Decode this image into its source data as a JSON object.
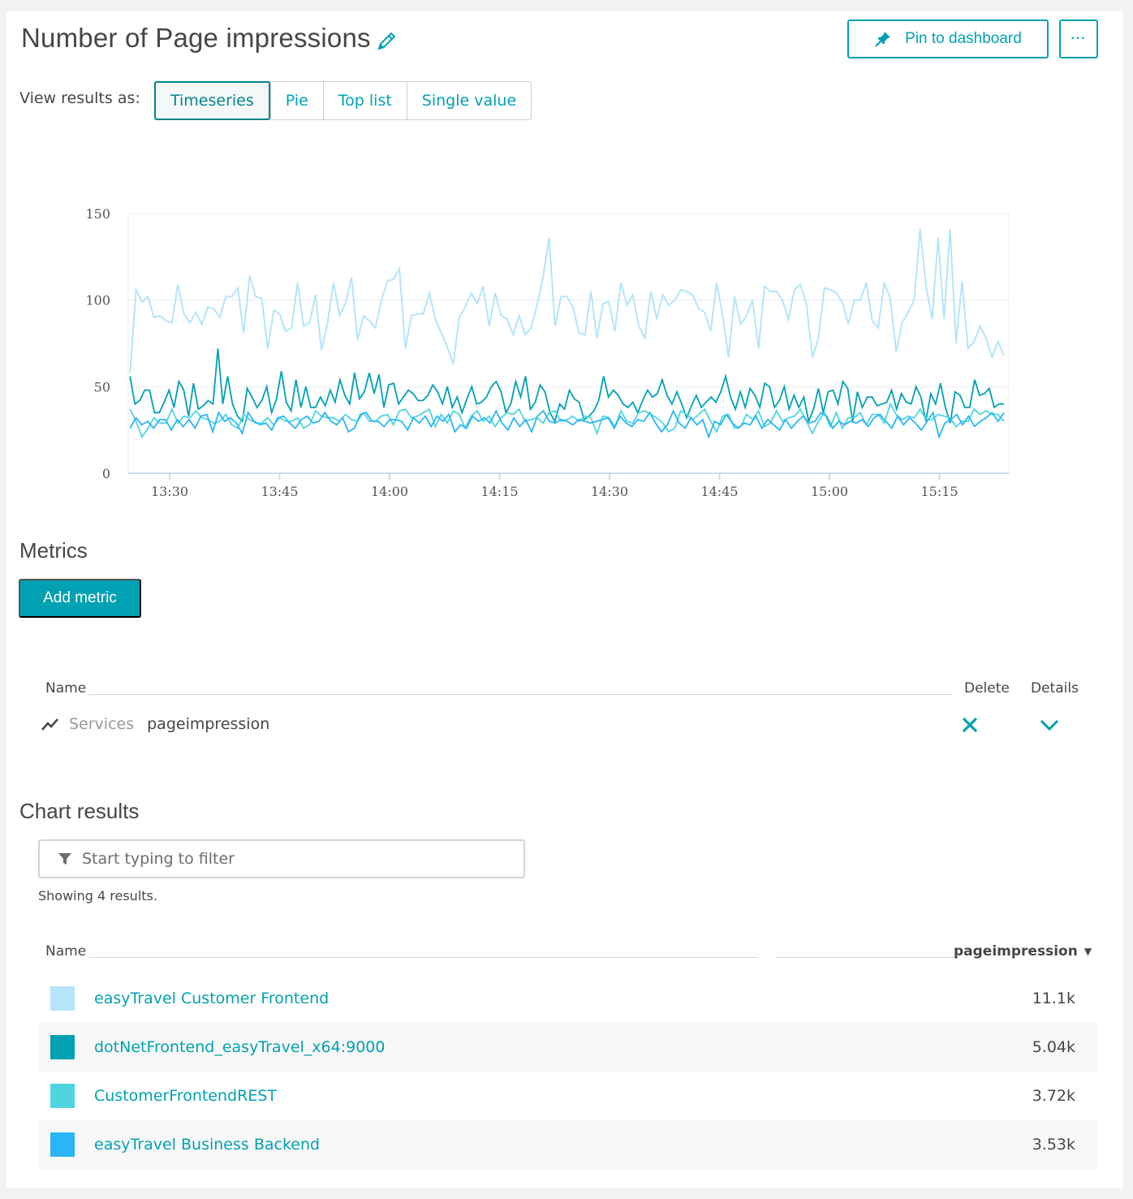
{
  "header": {
    "title": "Number of Page impressions",
    "edit_icon": "pencil-icon",
    "pin_label": "Pin to dashboard",
    "pin_icon": "pin-icon",
    "more_label": "···"
  },
  "view_switch": {
    "label": "View results as:",
    "options": [
      "Timeseries",
      "Pie",
      "Top list",
      "Single value"
    ],
    "selected": "Timeseries"
  },
  "chart_data": {
    "type": "line",
    "title": "",
    "xlabel": "",
    "ylabel": "",
    "ylim": [
      0,
      150
    ],
    "yticks": [
      0,
      50,
      100,
      150
    ],
    "xticks": [
      "13:30",
      "13:45",
      "14:00",
      "14:15",
      "14:30",
      "14:45",
      "15:00",
      "15:15"
    ],
    "x_start": "13:24",
    "x_end": "15:24",
    "interval_minutes": 1,
    "grid": true,
    "legend": "none",
    "series": [
      {
        "name": "easyTravel Customer Frontend",
        "color": "#b4e5f9",
        "values": [
          58,
          106,
          99,
          102,
          90,
          91,
          88,
          87,
          109,
          92,
          87,
          93,
          86,
          96,
          95,
          90,
          102,
          102,
          107,
          81,
          114,
          102,
          101,
          72,
          94,
          92,
          82,
          84,
          110,
          85,
          87,
          103,
          71,
          87,
          110,
          91,
          98,
          113,
          77,
          91,
          88,
          84,
          100,
          111,
          112,
          118,
          72,
          91,
          92,
          92,
          104,
          89,
          81,
          73,
          63,
          90,
          96,
          104,
          98,
          108,
          85,
          104,
          91,
          89,
          80,
          91,
          80,
          84,
          97,
          113,
          136,
          85,
          102,
          102,
          96,
          81,
          80,
          105,
          78,
          98,
          99,
          82,
          110,
          97,
          103,
          85,
          78,
          105,
          89,
          103,
          97,
          100,
          106,
          105,
          103,
          95,
          93,
          82,
          110,
          91,
          67,
          102,
          86,
          91,
          100,
          72,
          108,
          105,
          105,
          100,
          89,
          106,
          109,
          98,
          67,
          78,
          107,
          106,
          104,
          99,
          86,
          100,
          100,
          110,
          88,
          84,
          110,
          101,
          70,
          87,
          93,
          100,
          141,
          108,
          89,
          136,
          89,
          141,
          75,
          111,
          72,
          76,
          85,
          78,
          67,
          76,
          68
        ]
      },
      {
        "name": "dotNetFrontend_easyTravel_x64:9000",
        "color": "#00a1b2",
        "values": [
          56,
          40,
          42,
          48,
          48,
          35,
          35,
          41,
          48,
          38,
          53,
          48,
          33,
          52,
          37,
          39,
          42,
          40,
          72,
          40,
          56,
          40,
          33,
          30,
          49,
          44,
          38,
          42,
          50,
          35,
          43,
          59,
          41,
          36,
          54,
          38,
          50,
          38,
          38,
          44,
          39,
          48,
          41,
          54,
          45,
          40,
          58,
          43,
          47,
          58,
          46,
          57,
          38,
          51,
          52,
          40,
          44,
          48,
          46,
          42,
          42,
          45,
          51,
          47,
          40,
          50,
          38,
          44,
          35,
          43,
          50,
          40,
          41,
          44,
          50,
          53,
          47,
          35,
          40,
          53,
          44,
          56,
          37,
          41,
          51,
          47,
          35,
          30,
          40,
          37,
          48,
          43,
          41,
          31,
          33,
          36,
          42,
          56,
          44,
          48,
          45,
          40,
          38,
          41,
          35,
          42,
          48,
          44,
          46,
          54,
          45,
          40,
          47,
          40,
          32,
          39,
          45,
          38,
          41,
          44,
          41,
          47,
          56,
          44,
          37,
          47,
          38,
          49,
          45,
          38,
          52,
          50,
          38,
          42,
          50,
          37,
          45,
          38,
          44,
          30,
          37,
          49,
          35,
          47,
          48,
          40,
          53,
          49,
          30,
          47,
          38,
          44,
          44,
          39,
          40,
          41,
          48,
          37,
          46,
          41,
          40,
          50,
          44,
          30,
          46,
          40,
          52,
          38,
          29,
          47,
          45,
          38,
          38,
          54,
          45,
          46,
          49,
          38,
          40,
          40
        ]
      },
      {
        "name": "CustomerFrontendREST",
        "color": "#4fd5e0",
        "values": [
          37,
          30,
          21,
          26,
          32,
          29,
          29,
          37,
          29,
          33,
          32,
          36,
          32,
          31,
          29,
          30,
          34,
          28,
          26,
          34,
          31,
          29,
          29,
          32,
          28,
          32,
          30,
          30,
          32,
          26,
          28,
          36,
          33,
          32,
          32,
          30,
          34,
          31,
          30,
          35,
          30,
          30,
          33,
          34,
          28,
          36,
          37,
          32,
          33,
          35,
          37,
          27,
          34,
          29,
          36,
          34,
          26,
          33,
          36,
          30,
          33,
          27,
          32,
          35,
          34,
          37,
          30,
          31,
          32,
          29,
          35,
          36,
          30,
          31,
          33,
          30,
          33,
          32,
          23,
          33,
          32,
          27,
          36,
          30,
          29,
          35,
          36,
          34,
          32,
          29,
          24,
          26,
          36,
          34,
          31,
          34,
          37,
          30,
          24,
          33,
          34,
          26,
          27,
          34,
          31,
          36,
          27,
          29,
          36,
          30,
          32,
          33,
          37,
          30,
          23,
          30,
          35,
          27,
          35,
          26,
          32,
          32,
          35,
          28,
          34,
          34,
          29,
          40,
          34,
          31,
          33,
          32,
          37,
          31,
          31,
          34,
          33,
          32,
          27,
          30,
          30,
          37,
          34,
          36,
          34,
          34,
          30
        ]
      },
      {
        "name": "easyTravel Business Backend",
        "color": "#2ab6f4",
        "values": [
          26,
          32,
          28,
          30,
          26,
          31,
          31,
          25,
          31,
          27,
          31,
          26,
          33,
          34,
          24,
          35,
          30,
          32,
          29,
          23,
          35,
          30,
          28,
          29,
          25,
          32,
          33,
          29,
          26,
          31,
          33,
          29,
          30,
          35,
          30,
          28,
          32,
          24,
          26,
          34,
          35,
          30,
          30,
          27,
          31,
          31,
          30,
          25,
          32,
          29,
          33,
          27,
          33,
          30,
          34,
          24,
          28,
          26,
          33,
          30,
          32,
          29,
          36,
          29,
          25,
          32,
          27,
          31,
          24,
          33,
          36,
          30,
          29,
          31,
          30,
          28,
          31,
          30,
          29,
          30,
          31,
          32,
          26,
          33,
          29,
          27,
          31,
          30,
          35,
          29,
          24,
          28,
          36,
          29,
          26,
          32,
          28,
          31,
          21,
          30,
          28,
          34,
          29,
          26,
          29,
          28,
          33,
          26,
          31,
          28,
          25,
          31,
          26,
          30,
          33,
          29,
          30,
          35,
          33,
          26,
          30,
          28,
          30,
          29,
          31,
          27,
          32,
          34,
          30,
          26,
          33,
          28,
          32,
          29,
          25,
          30,
          35,
          21,
          29,
          31,
          34,
          28,
          33,
          27,
          30,
          32,
          35,
          30,
          35
        ]
      }
    ]
  },
  "metrics": {
    "title": "Metrics",
    "add_label": "Add metric",
    "col_name": "Name",
    "col_delete": "Delete",
    "col_details": "Details",
    "rows": [
      {
        "icon": "timeseries-icon",
        "category": "Services",
        "name": "pageimpression"
      }
    ]
  },
  "results": {
    "title": "Chart results",
    "filter_placeholder": "Start typing to filter",
    "filter_value": "",
    "count_text": "Showing 4 results.",
    "col_name": "Name",
    "col_metric": "pageimpression",
    "sort_indicator": "▼",
    "rows": [
      {
        "name": "easyTravel Customer Frontend",
        "value": "11.1k",
        "color": "#b4e5f9"
      },
      {
        "name": "dotNetFrontend_easyTravel_x64:9000",
        "value": "5.04k",
        "color": "#00a1b2"
      },
      {
        "name": "CustomerFrontendREST",
        "value": "3.72k",
        "color": "#4fd5e0"
      },
      {
        "name": "easyTravel Business Backend",
        "value": "3.53k",
        "color": "#2ab6f4"
      }
    ]
  }
}
